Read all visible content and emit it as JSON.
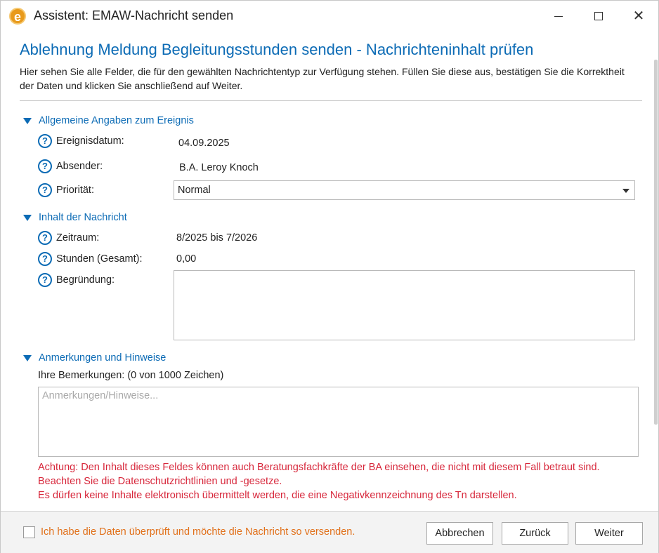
{
  "window": {
    "logo_letter": "e",
    "title": "Assistent: EMAW-Nachricht senden",
    "close_glyph": "✕"
  },
  "page": {
    "heading": "Ablehnung Meldung Begleitungsstunden senden - Nachrichteninhalt prüfen",
    "intro": "Hier sehen Sie alle Felder, die für den gewählten Nachrichtentyp zur Verfügung stehen. Füllen Sie diese aus, bestätigen Sie die Korrektheit der Daten und klicken Sie anschließend auf Weiter."
  },
  "section_general": {
    "title": "Allgemeine Angaben zum Ereignis",
    "event_date_label": "Ereignisdatum:",
    "event_date_value": "04.09.2025",
    "sender_label": "Absender:",
    "sender_value": "B.A. Leroy Knoch",
    "priority_label": "Priorität:",
    "priority_value": "Normal"
  },
  "section_content": {
    "title": "Inhalt der Nachricht",
    "period_label": "Zeitraum:",
    "period_value": "8/2025 bis 7/2026",
    "hours_label": "Stunden (Gesamt):",
    "hours_value": "0,00",
    "reason_label": "Begründung:",
    "reason_value": ""
  },
  "section_notes": {
    "title": "Anmerkungen und Hinweise",
    "remarks_label": "Ihre Bemerkungen: (0 von 1000 Zeichen)",
    "remarks_placeholder": "Anmerkungen/Hinweise...",
    "warning_lines": [
      "Achtung: Den Inhalt dieses Feldes können auch Beratungsfachkräfte der BA einsehen, die nicht mit diesem Fall betraut sind.",
      "Beachten Sie die Datenschutzrichtlinien und -gesetze.",
      "Es dürfen keine Inhalte elektronisch übermittelt werden, die eine Negativkennzeichnung des Tn darstellen."
    ]
  },
  "help_glyph": "?",
  "footer": {
    "confirm_label": "Ich habe die Daten überprüft und möchte die Nachricht so versenden.",
    "cancel_label": "Abbrechen",
    "back_label": "Zurück",
    "next_label": "Weiter"
  },
  "colors": {
    "accent": "#0c6bb5",
    "warning": "#d7263a",
    "confirm_text": "#e1701a",
    "logo": "#e89a1c"
  },
  "icons": [
    "app-logo-icon",
    "minimize-icon",
    "maximize-icon",
    "close-icon",
    "collapse-triangle-icon",
    "help-icon",
    "dropdown-caret-icon"
  ]
}
